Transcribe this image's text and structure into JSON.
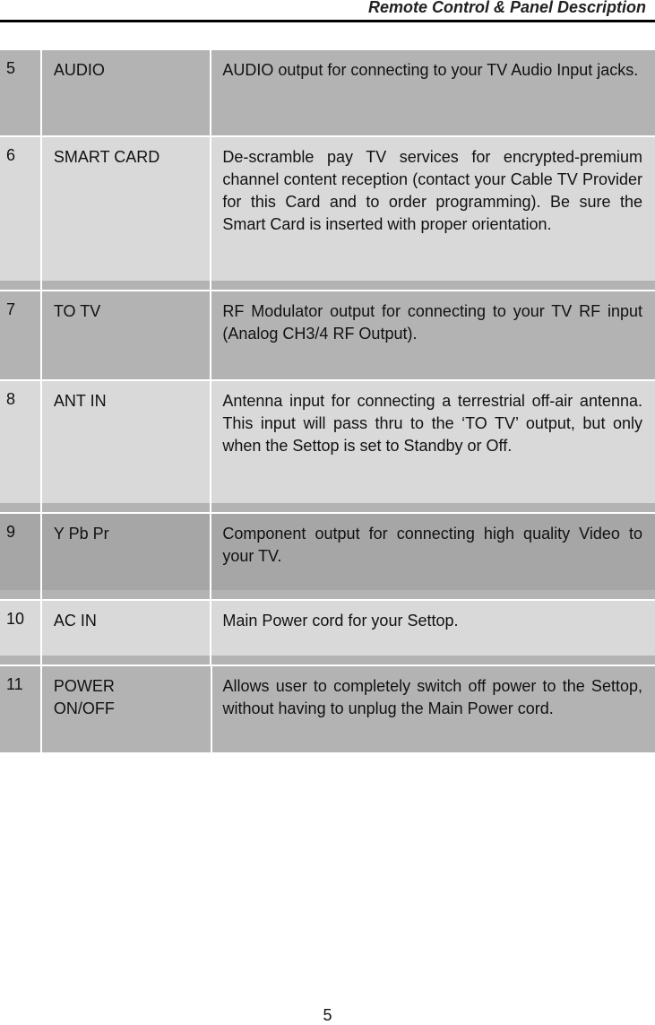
{
  "header": {
    "title": "Remote Control & Panel Description"
  },
  "rows": [
    {
      "num": "5",
      "name": "AUDIO",
      "desc": "AUDIO output for connecting to your TV Audio Input jacks."
    },
    {
      "num": "6",
      "name": "SMART CARD",
      "desc": "De-scramble pay TV services for encrypted-premium channel content reception (contact your Cable TV Provider for this Card and to order programming).  Be sure the Smart Card is inserted with proper orientation."
    },
    {
      "num": "7",
      "name": "TO TV",
      "desc": "RF Modulator output for connecting to your TV RF input (Analog CH3/4 RF Output)."
    },
    {
      "num": "8",
      "name": "ANT IN",
      "desc": "Antenna input for connecting a terrestrial off-air antenna.  This input will pass thru to the ‘TO TV’ output, but only when the Settop is set to Standby or Off."
    },
    {
      "num": "9",
      "name": "Y Pb Pr",
      "desc": "Component output for connecting high quality Video to your TV."
    },
    {
      "num": "10",
      "name": "AC IN",
      "desc": "Main Power cord for your Settop."
    },
    {
      "num": "11",
      "name": "POWER ON/OFF",
      "desc": "Allows user to completely switch off power to the Settop, without having to unplug the Main Power cord."
    }
  ],
  "footer": {
    "page_number": "5"
  }
}
